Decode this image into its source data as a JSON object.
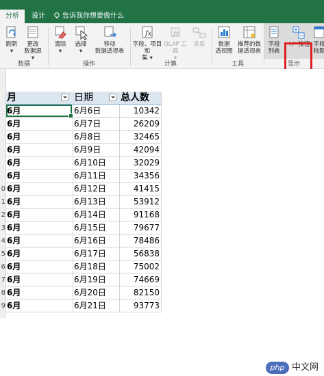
{
  "tabs": [
    {
      "label": "分析",
      "active": true
    },
    {
      "label": "设计",
      "active": false
    }
  ],
  "tell_me": "告诉我你想要做什么",
  "ribbon": {
    "refresh": "刷新",
    "change_source_1": "更改",
    "change_source_2": "数据源",
    "clear": "清除",
    "select": "选择",
    "move_1": "移动",
    "move_2": "数据透视表",
    "fields_items_1": "字段、项目和",
    "fields_items_2": "集",
    "olap": "OLAP 工具",
    "relationships": "关系",
    "pivot_chart_1": "数据",
    "pivot_chart_2": "透视图",
    "recommended_1": "推荐的数",
    "recommended_2": "据透视表",
    "field_list_1": "字段",
    "field_list_2": "列表",
    "plus_minus_1": "+/- 按钮",
    "field_headers_1": "字段",
    "field_headers_2": "标题",
    "group_data": "数据",
    "group_actions": "操作",
    "group_calc": "计算",
    "group_tools": "工具",
    "group_show": "显示"
  },
  "table": {
    "headers": [
      "月",
      "日期",
      "总人数"
    ],
    "rows": [
      {
        "rn": "",
        "month": "6月",
        "date": "6月6日",
        "total": "10342"
      },
      {
        "rn": "",
        "month": "6月",
        "date": "6月7日",
        "total": "26209"
      },
      {
        "rn": "",
        "month": "6月",
        "date": "6月8日",
        "total": "32465"
      },
      {
        "rn": "",
        "month": "6月",
        "date": "6月9日",
        "total": "42094"
      },
      {
        "rn": "",
        "month": "6月",
        "date": "6月10日",
        "total": "32029"
      },
      {
        "rn": "",
        "month": "6月",
        "date": "6月11日",
        "total": "34356"
      },
      {
        "rn": "0",
        "month": "6月",
        "date": "6月12日",
        "total": "41415"
      },
      {
        "rn": "1",
        "month": "6月",
        "date": "6月13日",
        "total": "53912"
      },
      {
        "rn": "2",
        "month": "6月",
        "date": "6月14日",
        "total": "91168"
      },
      {
        "rn": "3",
        "month": "6月",
        "date": "6月15日",
        "total": "79677"
      },
      {
        "rn": "4",
        "month": "6月",
        "date": "6月16日",
        "total": "78486"
      },
      {
        "rn": "5",
        "month": "6月",
        "date": "6月17日",
        "total": "56838"
      },
      {
        "rn": "6",
        "month": "6月",
        "date": "6月18日",
        "total": "75002"
      },
      {
        "rn": "7",
        "month": "6月",
        "date": "6月19日",
        "total": "74669"
      },
      {
        "rn": "8",
        "month": "6月",
        "date": "6月20日",
        "total": "82150"
      },
      {
        "rn": "9",
        "month": "6月",
        "date": "6月21日",
        "total": "93773"
      }
    ]
  },
  "watermark": {
    "logo": "php",
    "text": "中文网"
  },
  "colors": {
    "excel_green": "#217346",
    "header_fill": "#dce6f1",
    "highlight": "#e02020"
  }
}
